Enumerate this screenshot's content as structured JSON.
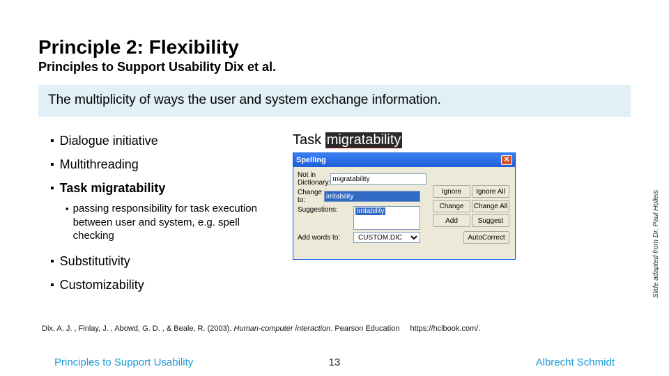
{
  "title": "Principle 2: Flexibility",
  "subtitle": "Principles to Support Usability Dix et al.",
  "definition": "The multiplicity of ways the user and system exchange information.",
  "bullets": {
    "b1": "Dialogue initiative",
    "b2": "Multithreading",
    "b3": "Task migratability",
    "sub3": "passing responsibility for task execution between user and system, e.g. spell checking",
    "b4": "Substitutivity",
    "b5": "Customizability"
  },
  "figure": {
    "title_prefix": "Task ",
    "title_highlight": "migratability",
    "dialog": {
      "title": "Spelling",
      "labels": {
        "not_in_dict": "Not in Dictionary:",
        "change_to": "Change to:",
        "suggestions": "Suggestions:",
        "add_words_to": "Add words to:"
      },
      "values": {
        "not_in_dict": "migratability",
        "change_to": "irritability",
        "suggestion_item": "irritability",
        "dict": "CUSTOM.DIC"
      },
      "buttons": {
        "ignore": "Ignore",
        "ignore_all": "Ignore All",
        "change": "Change",
        "change_all": "Change All",
        "add": "Add",
        "suggest": "Suggest",
        "autocorrect": "AutoCorrect"
      }
    }
  },
  "side_credit": "Slide adapted from Dr. Paul Holleis",
  "citation": {
    "text_a": "Dix, A. J. , Finlay, J. , Abowd, G. D. , & Beale, R. (2003). ",
    "text_b": "Human-computer interaction",
    "text_c": ". Pearson Education",
    "link": "https://hcibook.com/."
  },
  "footer": {
    "left": "Principles to Support Usability",
    "page": "13",
    "right": "Albrecht Schmidt"
  }
}
